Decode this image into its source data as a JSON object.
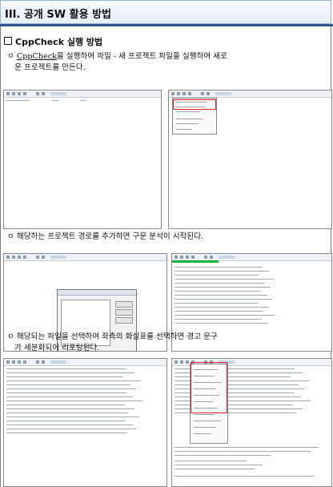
{
  "section": {
    "title": "III. 공개 SW 활용 방법"
  },
  "subsection": {
    "title": "CppCheck 실행 방법"
  },
  "steps": [
    {
      "bullet": "ㅇ",
      "link": "CppCheck",
      "line1": "을 실행하여 파일 - 새 프로젝트 파일을 실행하여 새로",
      "line2": "운 프로젝트를 만든다."
    },
    {
      "bullet": "ㅇ",
      "line1": "해당하는  프로젝트 경로를 추가하면 구문 분석이 시작된다."
    },
    {
      "bullet": "ㅇ",
      "line1": "해당되는 파일을 선택하여 좌측의 화살표를 선택하면 경고 문구",
      "line2": "가 세분화되어 리포팅된다."
    }
  ],
  "colors": {
    "header_rule": "#2f5597",
    "highlight": "#e0202a",
    "progress": "#19b33a"
  },
  "icons": [
    "checkbox-icon"
  ]
}
